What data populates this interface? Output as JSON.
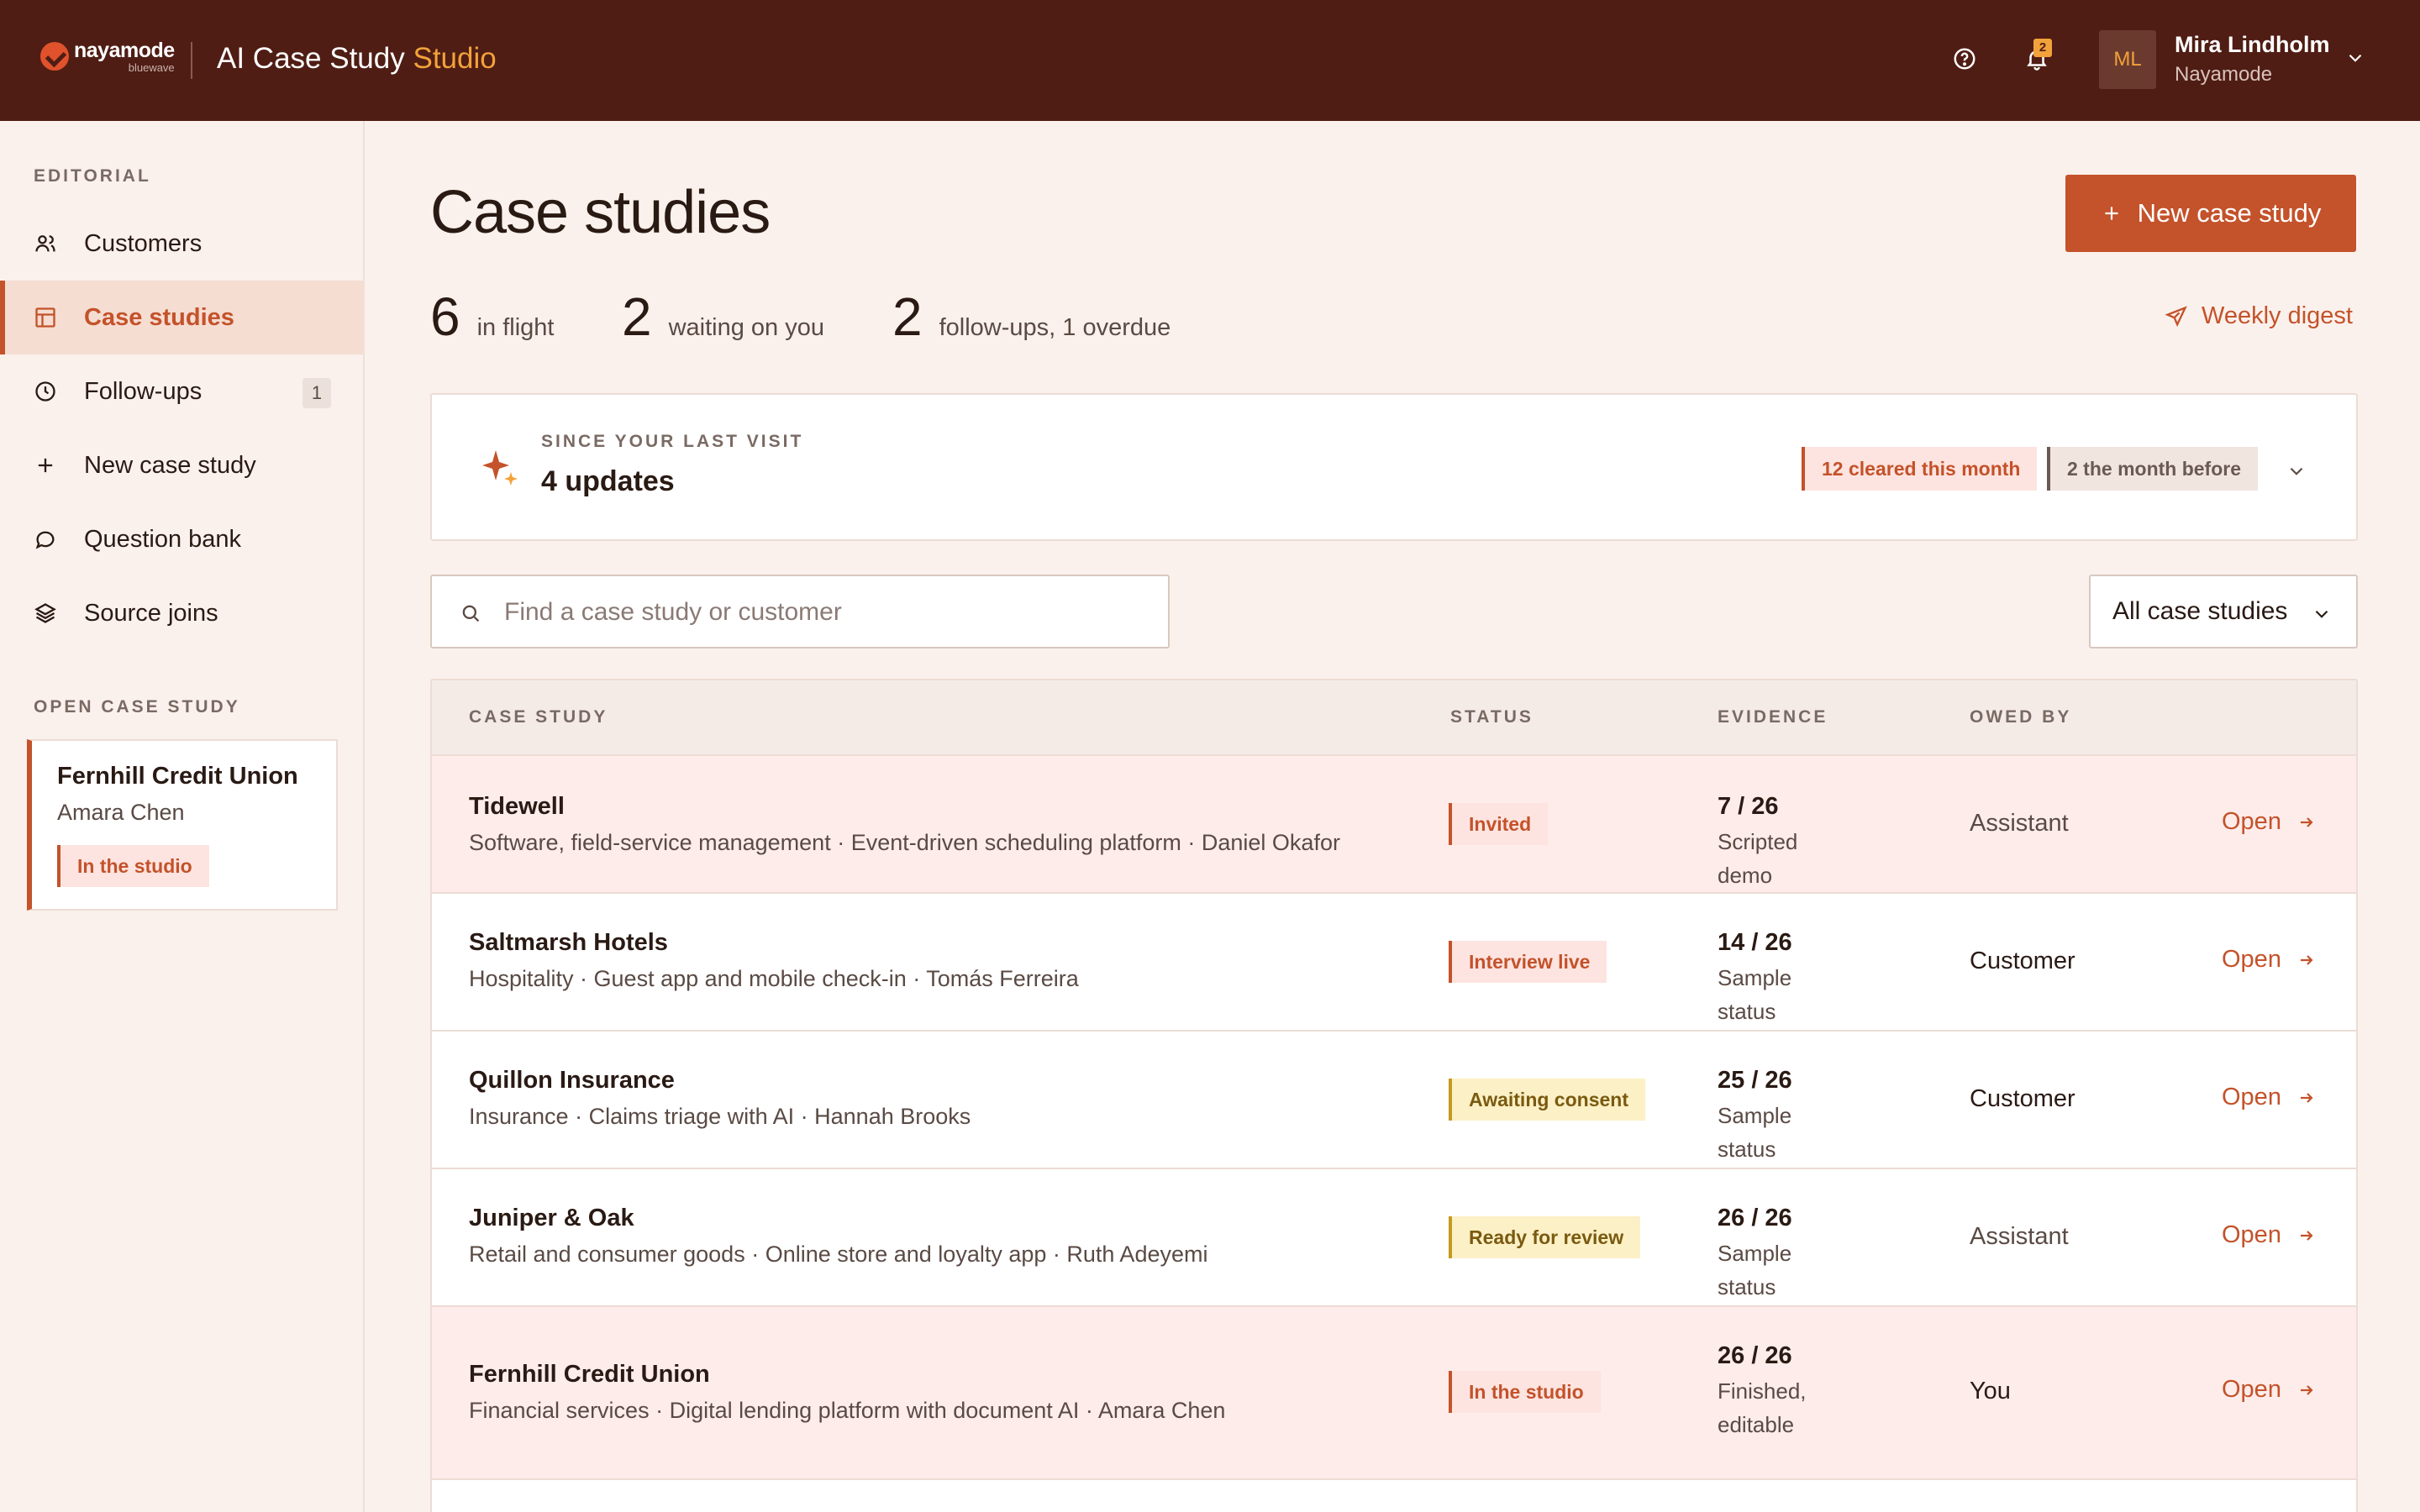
{
  "header": {
    "logo_word": "nayamode",
    "logo_sub": "bluewave",
    "app_title": "AI Case Study",
    "app_title_accent": "Studio",
    "notifications_count": "2",
    "user": {
      "initials": "ML",
      "name": "Mira Lindholm",
      "org": "Nayamode"
    }
  },
  "sidebar": {
    "section_label": "EDITORIAL",
    "items": [
      {
        "label": "Customers",
        "icon": "users-icon"
      },
      {
        "label": "Case studies",
        "icon": "layout-icon",
        "active": true
      },
      {
        "label": "Follow-ups",
        "icon": "clock-icon",
        "count": "1"
      },
      {
        "label": "New case study",
        "icon": "plus-icon"
      },
      {
        "label": "Question bank",
        "icon": "chat-icon"
      },
      {
        "label": "Source joins",
        "icon": "layers-icon"
      }
    ],
    "open_section_label": "OPEN CASE STUDY",
    "open_case": {
      "title": "Fernhill Credit Union",
      "person": "Amara Chen",
      "status": "In the studio"
    }
  },
  "main": {
    "title": "Case studies",
    "new_button": "New case study",
    "stats": [
      {
        "num": "6",
        "label": "in flight"
      },
      {
        "num": "2",
        "label": "waiting on you"
      },
      {
        "num": "2",
        "label": "follow-ups, 1 overdue"
      }
    ],
    "digest_link": "Weekly digest",
    "updates": {
      "eyebrow": "SINCE YOUR LAST VISIT",
      "count": "4 updates",
      "chip_current": "12 cleared this month",
      "chip_previous": "2 the month before"
    },
    "search": {
      "placeholder": "Find a case study or customer",
      "value": ""
    },
    "filter": {
      "selected": "All case studies"
    },
    "table": {
      "headers": {
        "case": "CASE STUDY",
        "status": "STATUS",
        "evidence": "EVIDENCE",
        "owed": "OWED BY"
      },
      "open_label": "Open",
      "rows": [
        {
          "name": "Tidewell",
          "meta": "Software, field-service management · Event-driven scheduling platform · Daniel Okafor",
          "status": "Invited",
          "evidence": "7 / 26",
          "evidence_note": "Scripted demo",
          "owed": "Assistant"
        },
        {
          "name": "Saltmarsh Hotels",
          "meta": "Hospitality · Guest app and mobile check-in · Tomás Ferreira",
          "status": "Interview live",
          "evidence": "14 / 26",
          "evidence_note": "Sample status",
          "owed": "Customer"
        },
        {
          "name": "Quillon Insurance",
          "meta": "Insurance · Claims triage with AI · Hannah Brooks",
          "status": "Awaiting consent",
          "evidence": "25 / 26",
          "evidence_note": "Sample status",
          "owed": "Customer"
        },
        {
          "name": "Juniper & Oak",
          "meta": "Retail and consumer goods · Online store and loyalty app · Ruth Adeyemi",
          "status": "Ready for review",
          "evidence": "26 / 26",
          "evidence_note": "Sample status",
          "owed": "Assistant"
        },
        {
          "name": "Fernhill Credit Union",
          "meta": "Financial services · Digital lending platform with document AI · Amara Chen",
          "status": "In the studio",
          "evidence": "26 / 26",
          "evidence_note": "Finished, editable",
          "owed": "You"
        }
      ]
    }
  },
  "colors": {
    "header_bg": "#4f1d14",
    "accent": "#c4522a",
    "accent_yellow": "#f2a23a",
    "page_bg": "#fbf1ec"
  }
}
